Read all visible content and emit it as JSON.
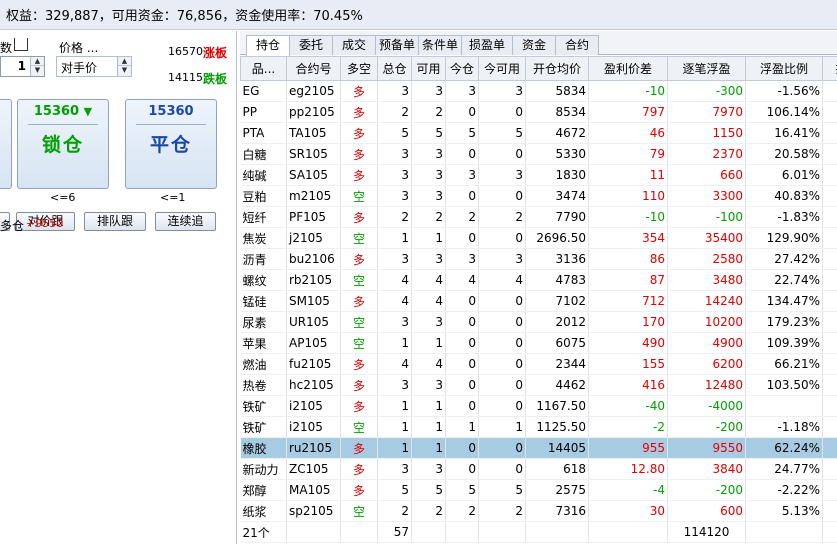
{
  "header": {
    "summary": "权益：329,887，可用资金：76,856，资金使用率：70.45%"
  },
  "order_panel": {
    "qty_label": "数",
    "qty_value": "1",
    "price_label": "价格 ...",
    "price_value": "对手价",
    "limit_up_price": "16570",
    "limit_up_label": "涨板",
    "limit_down_price": "14115",
    "limit_down_label": "跌板",
    "lock_price": "15360",
    "lock_price_arrow": "▼",
    "lock_label": "锁仓",
    "lock_note": "<=6",
    "close_price": "15360",
    "close_label": "平仓",
    "close_note": "<=1",
    "chase_counterparty": "对价跟",
    "chase_queue": "排队跟",
    "chase_continuous": "连续追",
    "position_label": "多仓",
    "position_value": "+9550",
    "colors": {
      "limit_up": "#e00000",
      "limit_down": "#00a000",
      "button_text": "#1a47a8",
      "lock_text": "#00a000"
    }
  },
  "tabs": [
    {
      "label": "持仓",
      "active": true
    },
    {
      "label": "委托",
      "active": false
    },
    {
      "label": "成交",
      "active": false
    },
    {
      "label": "预备单",
      "active": false
    },
    {
      "label": "条件单",
      "active": false
    },
    {
      "label": "损盈单",
      "active": false
    },
    {
      "label": "资金",
      "active": false
    },
    {
      "label": "合约",
      "active": false
    }
  ],
  "table": {
    "columns": [
      "品...",
      "合约号",
      "多空",
      "总仓",
      "可用",
      "今仓",
      "今可用",
      "开仓均价",
      "盈利价差",
      "逐笔浮盈",
      "浮盈比例",
      "损"
    ],
    "rows": [
      {
        "name": "EG",
        "code": "eg2105",
        "side": "多",
        "total": "3",
        "avail": "3",
        "today": "3",
        "today_avail": "3",
        "avg_price": "5834",
        "spread": "-10",
        "pnl": "-300",
        "ratio": "-1.56%"
      },
      {
        "name": "PP",
        "code": "pp2105",
        "side": "多",
        "total": "2",
        "avail": "2",
        "today": "0",
        "today_avail": "0",
        "avg_price": "8534",
        "spread": "797",
        "pnl": "7970",
        "ratio": "106.14%"
      },
      {
        "name": "PTA",
        "code": "TA105",
        "side": "多",
        "total": "5",
        "avail": "5",
        "today": "5",
        "today_avail": "5",
        "avg_price": "4672",
        "spread": "46",
        "pnl": "1150",
        "ratio": "16.41%"
      },
      {
        "name": "白糖",
        "code": "SR105",
        "side": "多",
        "total": "3",
        "avail": "3",
        "today": "0",
        "today_avail": "0",
        "avg_price": "5330",
        "spread": "79",
        "pnl": "2370",
        "ratio": "20.58%"
      },
      {
        "name": "纯碱",
        "code": "SA105",
        "side": "多",
        "total": "3",
        "avail": "3",
        "today": "3",
        "today_avail": "3",
        "avg_price": "1830",
        "spread": "11",
        "pnl": "660",
        "ratio": "6.01%"
      },
      {
        "name": "豆粕",
        "code": "m2105",
        "side": "空",
        "total": "3",
        "avail": "3",
        "today": "0",
        "today_avail": "0",
        "avg_price": "3474",
        "spread": "110",
        "pnl": "3300",
        "ratio": "40.83%"
      },
      {
        "name": "短纤",
        "code": "PF105",
        "side": "多",
        "total": "2",
        "avail": "2",
        "today": "2",
        "today_avail": "2",
        "avg_price": "7790",
        "spread": "-10",
        "pnl": "-100",
        "ratio": "-1.83%"
      },
      {
        "name": "焦炭",
        "code": "j2105",
        "side": "空",
        "total": "1",
        "avail": "1",
        "today": "0",
        "today_avail": "0",
        "avg_price": "2696.50",
        "spread": "354",
        "pnl": "35400",
        "ratio": "129.90%"
      },
      {
        "name": "沥青",
        "code": "bu2106",
        "side": "多",
        "total": "3",
        "avail": "3",
        "today": "3",
        "today_avail": "3",
        "avg_price": "3136",
        "spread": "86",
        "pnl": "2580",
        "ratio": "27.42%"
      },
      {
        "name": "螺纹",
        "code": "rb2105",
        "side": "空",
        "total": "4",
        "avail": "4",
        "today": "4",
        "today_avail": "4",
        "avg_price": "4783",
        "spread": "87",
        "pnl": "3480",
        "ratio": "22.74%"
      },
      {
        "name": "锰硅",
        "code": "SM105",
        "side": "多",
        "total": "4",
        "avail": "4",
        "today": "0",
        "today_avail": "0",
        "avg_price": "7102",
        "spread": "712",
        "pnl": "14240",
        "ratio": "134.47%"
      },
      {
        "name": "尿素",
        "code": "UR105",
        "side": "空",
        "total": "3",
        "avail": "3",
        "today": "0",
        "today_avail": "0",
        "avg_price": "2012",
        "spread": "170",
        "pnl": "10200",
        "ratio": "179.23%"
      },
      {
        "name": "苹果",
        "code": "AP105",
        "side": "空",
        "total": "1",
        "avail": "1",
        "today": "0",
        "today_avail": "0",
        "avg_price": "6075",
        "spread": "490",
        "pnl": "4900",
        "ratio": "109.39%"
      },
      {
        "name": "燃油",
        "code": "fu2105",
        "side": "多",
        "total": "4",
        "avail": "4",
        "today": "0",
        "today_avail": "0",
        "avg_price": "2344",
        "spread": "155",
        "pnl": "6200",
        "ratio": "66.21%"
      },
      {
        "name": "热卷",
        "code": "hc2105",
        "side": "多",
        "total": "3",
        "avail": "3",
        "today": "0",
        "today_avail": "0",
        "avg_price": "4462",
        "spread": "416",
        "pnl": "12480",
        "ratio": "103.50%"
      },
      {
        "name": "铁矿",
        "code": "i2105",
        "side": "多",
        "total": "1",
        "avail": "1",
        "today": "0",
        "today_avail": "0",
        "avg_price": "1167.50",
        "spread": "-40",
        "pnl": "-4000",
        "ratio": ""
      },
      {
        "name": "铁矿",
        "code": "i2105",
        "side": "空",
        "total": "1",
        "avail": "1",
        "today": "1",
        "today_avail": "1",
        "avg_price": "1125.50",
        "spread": "-2",
        "pnl": "-200",
        "ratio": "-1.18%"
      },
      {
        "name": "橡胶",
        "code": "ru2105",
        "side": "多",
        "total": "1",
        "avail": "1",
        "today": "0",
        "today_avail": "0",
        "avg_price": "14405",
        "spread": "955",
        "pnl": "9550",
        "ratio": "62.24%",
        "selected": true
      },
      {
        "name": "新动力",
        "code": "ZC105",
        "side": "多",
        "total": "3",
        "avail": "3",
        "today": "0",
        "today_avail": "0",
        "avg_price": "618",
        "spread": "12.80",
        "pnl": "3840",
        "ratio": "24.77%"
      },
      {
        "name": "郑醇",
        "code": "MA105",
        "side": "多",
        "total": "5",
        "avail": "5",
        "today": "5",
        "today_avail": "5",
        "avg_price": "2575",
        "spread": "-4",
        "pnl": "-200",
        "ratio": "-2.22%"
      },
      {
        "name": "纸浆",
        "code": "sp2105",
        "side": "空",
        "total": "2",
        "avail": "2",
        "today": "2",
        "today_avail": "2",
        "avg_price": "7316",
        "spread": "30",
        "pnl": "600",
        "ratio": "5.13%"
      }
    ],
    "footer": {
      "count": "21个",
      "total": "57",
      "pnl_total": "114120"
    }
  }
}
